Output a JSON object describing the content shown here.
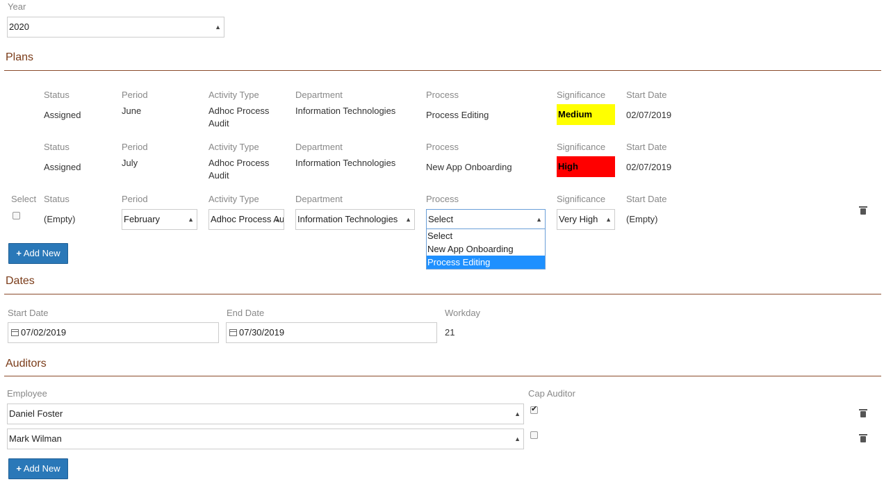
{
  "year": {
    "label": "Year",
    "value": "2020"
  },
  "plans": {
    "title": "Plans",
    "headers": {
      "select": "Select",
      "status": "Status",
      "period": "Period",
      "activity_type": "Activity Type",
      "department": "Department",
      "process": "Process",
      "significance": "Significance",
      "start_date": "Start Date"
    },
    "rows": [
      {
        "status": "Assigned",
        "period": "June",
        "activity_type": "Adhoc Process Audit",
        "department": "Information Technologies",
        "process": "Process Editing",
        "significance": "Medium",
        "significance_color": "#ffff00",
        "start_date": "02/07/2019"
      },
      {
        "status": "Assigned",
        "period": "July",
        "activity_type": "Adhoc Process Audit",
        "department": "Information Technologies",
        "process": "New App Onboarding",
        "significance": "High",
        "significance_color": "#ff0000",
        "start_date": "02/07/2019"
      }
    ],
    "edit_row": {
      "status": "(Empty)",
      "period": "February",
      "activity_type": "Adhoc Process Audit",
      "department": "Information Technologies",
      "process": "Select",
      "significance": "Very High",
      "start_date": "(Empty)",
      "process_options": [
        "Select",
        "New App Onboarding",
        "Process Editing"
      ],
      "highlighted_option": "Process Editing"
    },
    "add_new": "Add New"
  },
  "dates": {
    "title": "Dates",
    "start_label": "Start Date",
    "start_value": "07/02/2019",
    "end_label": "End Date",
    "end_value": "07/30/2019",
    "workday_label": "Workday",
    "workday_value": "21"
  },
  "auditors": {
    "title": "Auditors",
    "employee_label": "Employee",
    "cap_label": "Cap Auditor",
    "rows": [
      {
        "employee": "Daniel Foster",
        "cap": true
      },
      {
        "employee": "Mark Wilman",
        "cap": false
      }
    ],
    "add_new": "Add New"
  },
  "colors": {
    "accent": "#2a78b8",
    "section": "#7a3b18",
    "dropdown_highlight": "#1e90ff"
  },
  "icons": {
    "add": "plus-icon",
    "delete": "trash-icon",
    "calendar": "calendar-icon",
    "select": "sort-arrows-icon"
  }
}
